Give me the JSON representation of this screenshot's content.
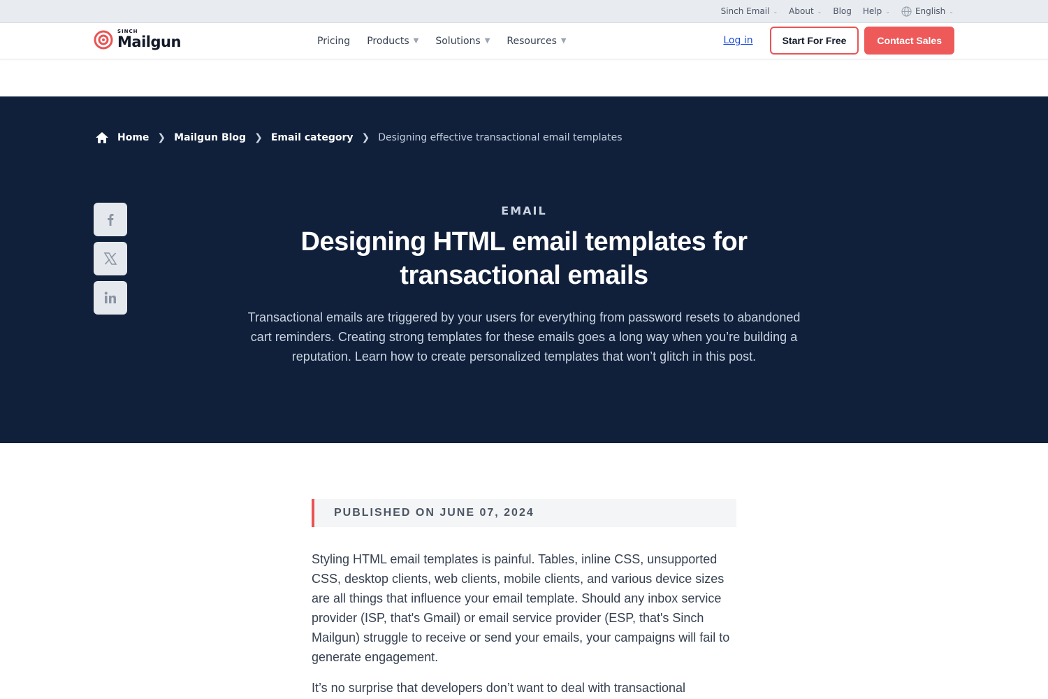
{
  "utility_nav": {
    "items": [
      {
        "label": "Sinch Email",
        "dropdown": true
      },
      {
        "label": "About",
        "dropdown": true
      },
      {
        "label": "Blog",
        "dropdown": false
      },
      {
        "label": "Help",
        "dropdown": true
      }
    ],
    "language": "English"
  },
  "logo": {
    "sub": "SINCH",
    "main": "Mailgun"
  },
  "primary_nav": {
    "items": [
      {
        "label": "Pricing",
        "dropdown": false
      },
      {
        "label": "Products",
        "dropdown": true
      },
      {
        "label": "Solutions",
        "dropdown": true
      },
      {
        "label": "Resources",
        "dropdown": true
      }
    ]
  },
  "header_actions": {
    "login": "Log in",
    "start_free": "Start For Free",
    "contact_sales": "Contact Sales"
  },
  "breadcrumb": {
    "home": "Home",
    "blog": "Mailgun Blog",
    "category": "Email category",
    "current": "Designing effective transactional email templates"
  },
  "share": {
    "icons": [
      "facebook-icon",
      "x-twitter-icon",
      "linkedin-icon"
    ]
  },
  "hero": {
    "category": "EMAIL",
    "title": "Designing HTML email templates for transactional emails",
    "description": "Transactional emails are triggered by your users for everything from password resets to abandoned cart reminders. Creating strong templates for these emails goes a long way when you’re building a reputation. Learn how to create personalized templates that won’t glitch in this post."
  },
  "article": {
    "published": "PUBLISHED ON JUNE 07, 2024",
    "paragraphs": [
      "Styling HTML email templates is painful. Tables, inline CSS, unsupported CSS, desktop clients, web clients, mobile clients, and various device sizes are all things that influence your email template. Should any inbox service provider (ISP, that's Gmail) or email service provider (ESP, that's Sinch Mailgun) struggle to receive or send your emails, your campaigns will fail to generate engagement.",
      "It’s no surprise that developers don’t want to deal with transactional"
    ]
  },
  "colors": {
    "brand_red": "#e95454",
    "hero_bg": "#10203b",
    "link_blue": "#1d4ed8"
  }
}
